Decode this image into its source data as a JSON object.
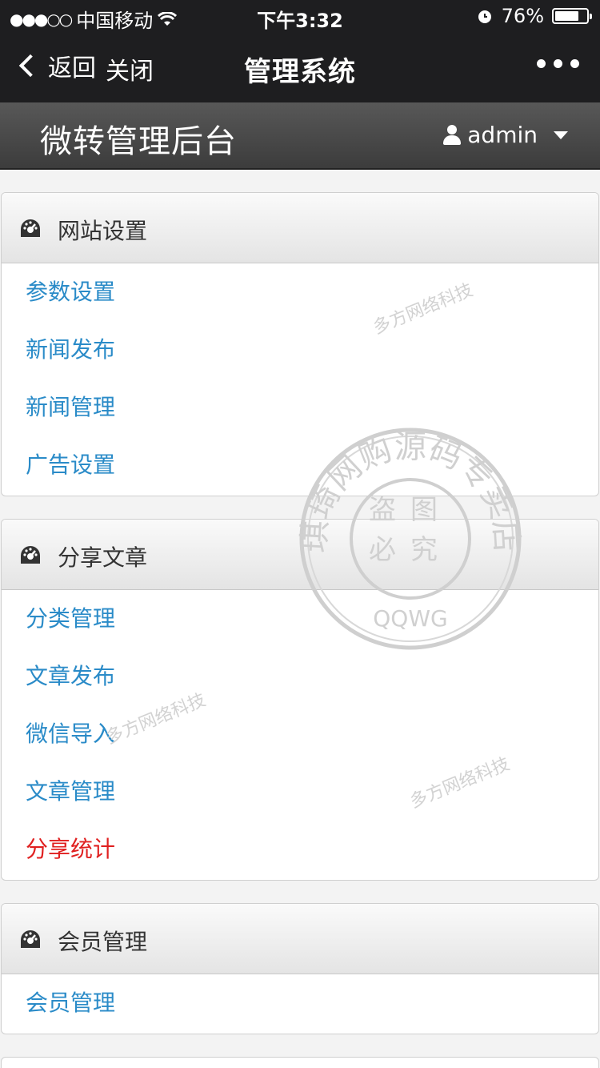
{
  "status": {
    "carrier": "中国移动",
    "time": "下午3:32",
    "battery_pct": "76%",
    "battery_level": 0.76
  },
  "nav": {
    "back": "返回",
    "close": "关闭",
    "title": "管理系统"
  },
  "header": {
    "brand": "微转管理后台",
    "user": "admin"
  },
  "sections": [
    {
      "title": "网站设置",
      "items": [
        "参数设置",
        "新闻发布",
        "新闻管理",
        "广告设置"
      ]
    },
    {
      "title": "分享文章",
      "items": [
        "分类管理",
        "文章发布",
        "微信导入",
        "文章管理",
        "分享统计"
      ]
    },
    {
      "title": "会员管理",
      "items": [
        "会员管理"
      ]
    }
  ],
  "watermark": {
    "stamp_ring": "琪琦网购源码专卖店",
    "stamp_center_top": "盗图",
    "stamp_center_bottom": "必究",
    "stamp_bottom": "QQWG",
    "text": "多方网络科技"
  },
  "colors": {
    "link": "#2a8bc8",
    "active_link": "#e02020",
    "bar": "#1e1e20"
  }
}
